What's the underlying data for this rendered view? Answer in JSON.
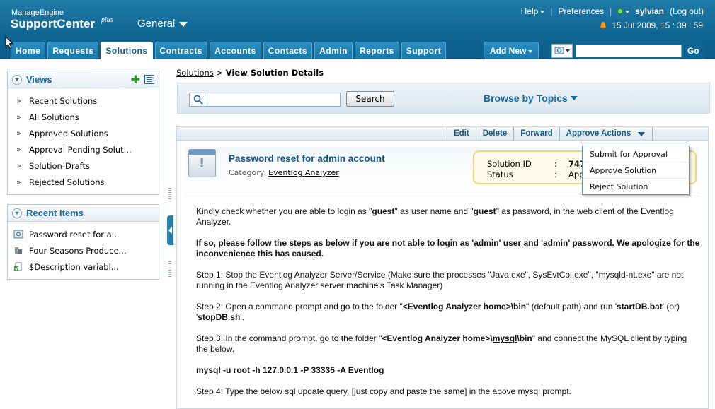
{
  "header": {
    "brand_top": "ManageEngine",
    "brand_main": "SupportCenter",
    "brand_sup": "plus",
    "workspace": "General",
    "help": "Help",
    "preferences": "Preferences",
    "user": "sylvian",
    "logout": "(Log out)",
    "datetime": "15 Jul 2009, 15 : 39 : 59",
    "tabs": [
      "Home",
      "Requests",
      "Solutions",
      "Contracts",
      "Accounts",
      "Contacts",
      "Admin",
      "Reports",
      "Support"
    ],
    "active_tab": "Solutions",
    "add_new": "Add New",
    "go": "Go",
    "search_value": ""
  },
  "views": {
    "title": "Views",
    "items": [
      "Recent Solutions",
      "All Solutions",
      "Approved Solutions",
      "Approval Pending Solut...",
      "Solution-Drafts",
      "Rejected Solutions"
    ]
  },
  "recent": {
    "title": "Recent Items",
    "items": [
      "Password reset for a...",
      "Four Seasons Produce...",
      "$Description variabl..."
    ]
  },
  "breadcrumb": {
    "root": "Solutions",
    "sep": ">",
    "current": "View Solution Details"
  },
  "search": {
    "value": "",
    "button": "Search",
    "browse": "Browse by Topics"
  },
  "actions": [
    "Edit",
    "Delete",
    "Forward",
    "Approve Actions"
  ],
  "approve_menu": [
    "Submit for Approval",
    "Approve Solution",
    "Reject Solution"
  ],
  "solution": {
    "title": "Password reset for admin account",
    "category_label": "Category:",
    "category": "Eventlog Analyzer",
    "id_label": "Solution ID",
    "id_value": "747",
    "status_label": "Status",
    "status_value": "App",
    "colon": ":"
  },
  "content": {
    "p1_a": "Kindly check whether you are able to login as \"",
    "p1_guest1": "guest",
    "p1_b": "\" as user name and \"",
    "p1_guest2": "guest",
    "p1_c": "\" as password, in the web client of the Eventlog Analyzer.",
    "p2": "If so, please follow the steps as below if you are not able to login as 'admin' user and 'admin' password.  We apologize for the inconvenience this has caused.",
    "p3": "Step 1:  Stop the Eventlog Analyzer Server/Service (Make sure the processes \"Java.exe\", SysEvtCol.exe\", \"mysqld-nt.exe\" are not running in the Eventlog Analyzer server machine's Task Manager)",
    "p4_a": "Step 2:  Open a command prompt and go to the folder  \"",
    "p4_b": "<Eventlog Analyzer home>\\bin",
    "p4_c": "\" (default path) and run '",
    "p4_d": "startDB.bat",
    "p4_e": "' (or) '",
    "p4_f": "stopDB.sh",
    "p4_g": "'.",
    "p5_a": "Step 3:  In the command prompt, go to the folder \"",
    "p5_b": "<Eventlog Analyzer home>\\",
    "p5_c": "mysql",
    "p5_d": "\\bin",
    "p5_e": "\" and connect the MySQL client by typing the below,",
    "p6": "mysql  -u  root  -h  127.0.0.1  -P 33335 -A Eventlog",
    "p7": "Step 4:  Type the below sql update query, [just copy and paste the same] in the above mysql prompt."
  }
}
